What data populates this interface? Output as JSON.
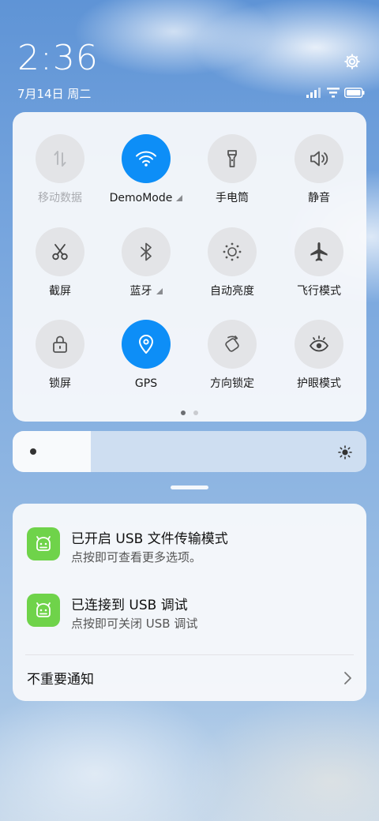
{
  "status_bar": {
    "time": "2:36",
    "date": "7月14日 周二"
  },
  "quick_settings": {
    "tiles": [
      {
        "label": "移动数据",
        "icon": "mobile-data-icon",
        "state": "disabled",
        "has_dropdown": false
      },
      {
        "label": "DemoMode",
        "icon": "wifi-icon",
        "state": "on",
        "has_dropdown": true
      },
      {
        "label": "手电筒",
        "icon": "flashlight-icon",
        "state": "off",
        "has_dropdown": false
      },
      {
        "label": "静音",
        "icon": "speaker-icon",
        "state": "off",
        "has_dropdown": false
      },
      {
        "label": "截屏",
        "icon": "scissors-icon",
        "state": "off",
        "has_dropdown": false
      },
      {
        "label": "蓝牙",
        "icon": "bluetooth-icon",
        "state": "off",
        "has_dropdown": true
      },
      {
        "label": "自动亮度",
        "icon": "auto-brightness-icon",
        "state": "off",
        "has_dropdown": false
      },
      {
        "label": "飞行模式",
        "icon": "airplane-icon",
        "state": "off",
        "has_dropdown": false
      },
      {
        "label": "锁屏",
        "icon": "lock-icon",
        "state": "off",
        "has_dropdown": false
      },
      {
        "label": "GPS",
        "icon": "location-pin-icon",
        "state": "on",
        "has_dropdown": false
      },
      {
        "label": "方向锁定",
        "icon": "rotation-lock-icon",
        "state": "off",
        "has_dropdown": false
      },
      {
        "label": "护眼模式",
        "icon": "eye-icon",
        "state": "off",
        "has_dropdown": false
      }
    ],
    "page_count": 2,
    "current_page": 1
  },
  "brightness": {
    "level": 0.22
  },
  "notifications": {
    "items": [
      {
        "title": "已开启 USB 文件传输模式",
        "text": "点按即可查看更多选项。",
        "icon": "android-icon"
      },
      {
        "title": "已连接到 USB 调试",
        "text": "点按即可关闭 USB 调试",
        "icon": "android-icon"
      }
    ],
    "unimportant_label": "不重要通知"
  },
  "colors": {
    "accent": "#0d8ef7",
    "tile_off": "#e3e4e7",
    "app_icon": "#6fd34a"
  }
}
